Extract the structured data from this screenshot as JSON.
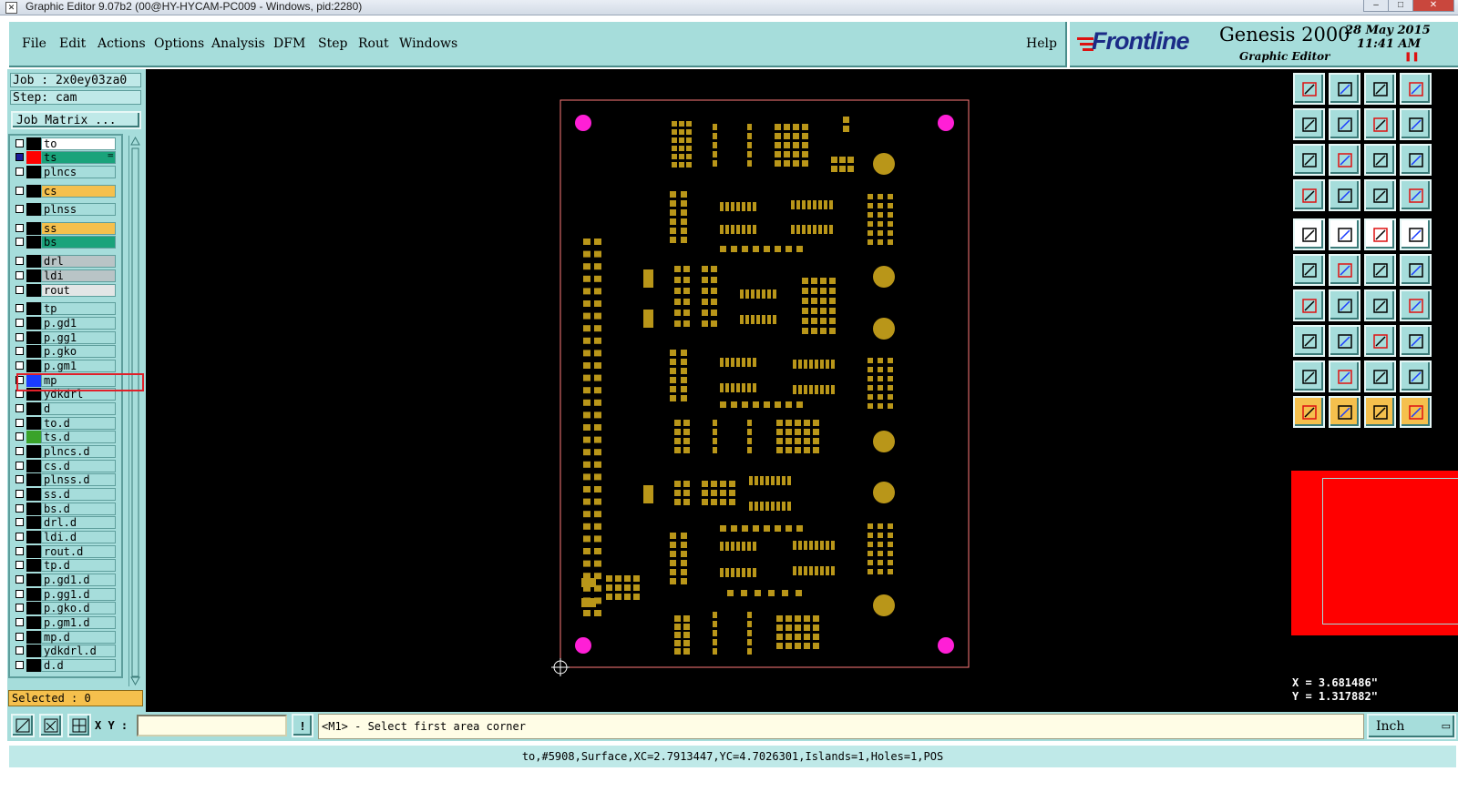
{
  "window": {
    "title": "Graphic Editor 9.07b2 (00@HY-HYCAM-PC009 - Windows, pid:2280)",
    "controls": [
      "–",
      "□",
      "✕"
    ]
  },
  "menu": {
    "file": "File",
    "edit": "Edit",
    "actions": "Actions",
    "options": "Options",
    "analysis": "Analysis",
    "dfm": "DFM",
    "step": "Step",
    "rout": "Rout",
    "windows": "Windows",
    "help": "Help"
  },
  "brand": {
    "logo": "Frontline",
    "product": "Genesis 2000",
    "subtitle": "Graphic Editor",
    "date": "28 May 2015",
    "time": "11:41 AM",
    "pause_glyph": "❚❚"
  },
  "job": {
    "job_label": "Job : 2x0ey03za0",
    "step_label": "Step: cam",
    "matrix_button": "Job Matrix ..."
  },
  "layers": [
    {
      "name": "to",
      "swatch": "#000000",
      "color": "#ffffff",
      "check": "#ffffff"
    },
    {
      "name": "ts",
      "swatch": "#ff0000",
      "color": "#1aa37b",
      "check": "#1a1a9a",
      "suffix": "="
    },
    {
      "name": "plncs",
      "swatch": "#000000",
      "color": "#a6dddb"
    },
    {
      "name": "cs",
      "swatch": "#000000",
      "color": "#f5c04d"
    },
    {
      "name": "plnss",
      "swatch": "#000000",
      "color": "#a6dddb"
    },
    {
      "name": "ss",
      "swatch": "#000000",
      "color": "#f5c04d"
    },
    {
      "name": "bs",
      "swatch": "#000000",
      "color": "#1aa37b"
    },
    {
      "name": "drl",
      "swatch": "#000000",
      "color": "#b9c4c6"
    },
    {
      "name": "ldi",
      "swatch": "#000000",
      "color": "#b9c4c6"
    },
    {
      "name": "rout",
      "swatch": "#000000",
      "color": "#e3e6e6"
    },
    {
      "name": "tp",
      "swatch": "#000000",
      "color": "#a6dddb"
    },
    {
      "name": "p.gd1",
      "swatch": "#000000",
      "color": "#a6dddb"
    },
    {
      "name": "p.gg1",
      "swatch": "#000000",
      "color": "#a6dddb"
    },
    {
      "name": "p.gko",
      "swatch": "#000000",
      "color": "#a6dddb"
    },
    {
      "name": "p.gm1",
      "swatch": "#000000",
      "color": "#a6dddb"
    },
    {
      "name": "mp",
      "swatch": "#1a3cff",
      "color": "#a6dddb"
    },
    {
      "name": "ydkdrl",
      "swatch": "#000000",
      "color": "#a6dddb"
    },
    {
      "name": "d",
      "swatch": "#000000",
      "color": "#a6dddb"
    },
    {
      "name": "to.d",
      "swatch": "#000000",
      "color": "#a6dddb"
    },
    {
      "name": "ts.d",
      "swatch": "#3aa32a",
      "color": "#a6dddb"
    },
    {
      "name": "plncs.d",
      "swatch": "#000000",
      "color": "#a6dddb"
    },
    {
      "name": "cs.d",
      "swatch": "#000000",
      "color": "#a6dddb"
    },
    {
      "name": "plnss.d",
      "swatch": "#000000",
      "color": "#a6dddb"
    },
    {
      "name": "ss.d",
      "swatch": "#000000",
      "color": "#a6dddb"
    },
    {
      "name": "bs.d",
      "swatch": "#000000",
      "color": "#a6dddb"
    },
    {
      "name": "drl.d",
      "swatch": "#000000",
      "color": "#a6dddb"
    },
    {
      "name": "ldi.d",
      "swatch": "#000000",
      "color": "#a6dddb"
    },
    {
      "name": "rout.d",
      "swatch": "#000000",
      "color": "#a6dddb"
    },
    {
      "name": "tp.d",
      "swatch": "#000000",
      "color": "#a6dddb"
    },
    {
      "name": "p.gd1.d",
      "swatch": "#000000",
      "color": "#a6dddb"
    },
    {
      "name": "p.gg1.d",
      "swatch": "#000000",
      "color": "#a6dddb"
    },
    {
      "name": "p.gko.d",
      "swatch": "#000000",
      "color": "#a6dddb"
    },
    {
      "name": "p.gm1.d",
      "swatch": "#000000",
      "color": "#a6dddb"
    },
    {
      "name": "mp.d",
      "swatch": "#000000",
      "color": "#a6dddb"
    },
    {
      "name": "ydkdrl.d",
      "swatch": "#000000",
      "color": "#a6dddb"
    },
    {
      "name": "d.d",
      "swatch": "#000000",
      "color": "#a6dddb"
    }
  ],
  "selected_label": "Selected : 0",
  "coords": {
    "x": "X = 3.681486\"",
    "y": "Y = 1.317882\""
  },
  "bottom": {
    "xy_label": "X Y :",
    "xy_value": "",
    "prompt": "<M1> - Select first area corner",
    "units": "Inch",
    "status": "to,#5908,Surface,XC=2.7913447,YC=4.7026301,Islands=1,Holes=1,POS"
  },
  "colors": {
    "pad": "#b99619",
    "fiducial": "#ff1fd6",
    "outline": "#ff7a7a",
    "panel": "#a6dddb",
    "highlight_box": "#e0202a"
  }
}
